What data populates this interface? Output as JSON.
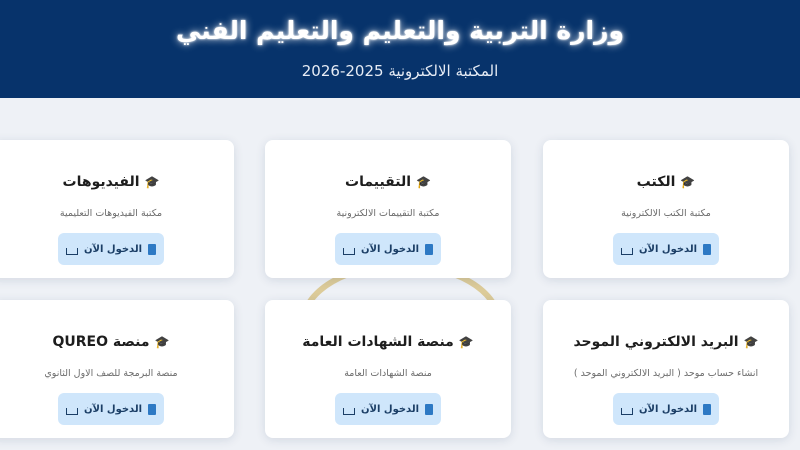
{
  "header": {
    "title": "وزارة التربية والتعليم والتعليم الفني",
    "subtitle": "المكتبة الالكترونية 2025-2026"
  },
  "cards": [
    {
      "title": "الكتب",
      "description": "مكتبة الكتب الالكترونية",
      "button": "الدخول الآن"
    },
    {
      "title": "التقييمات",
      "description": "مكتبة التقييمات الالكترونية",
      "button": "الدخول الآن"
    },
    {
      "title": "الفيديوهات",
      "description": "مكتبة الفيديوهات التعليمية",
      "button": "الدخول الآن"
    },
    {
      "title": "البريد الالكتروني الموحد",
      "description": "انشاء حساب موحد ( البريد الالكتروني الموحد )",
      "button": "الدخول الآن"
    },
    {
      "title": "منصة الشهادات العامة",
      "description": "منصة الشهادات العامة",
      "button": "الدخول الآن"
    },
    {
      "title": "منصة QUREO",
      "description": "منصة البرمجة للصف الاول الثانوي",
      "button": "الدخول الآن"
    }
  ],
  "icons": {
    "card_title": "graduation-cap-icon",
    "button_left": "tray-download-icon",
    "button_right": "book-icon"
  },
  "colors": {
    "header_bg": "#07336b",
    "button_bg": "#cfe6fb",
    "page_bg": "#eef1f6"
  }
}
